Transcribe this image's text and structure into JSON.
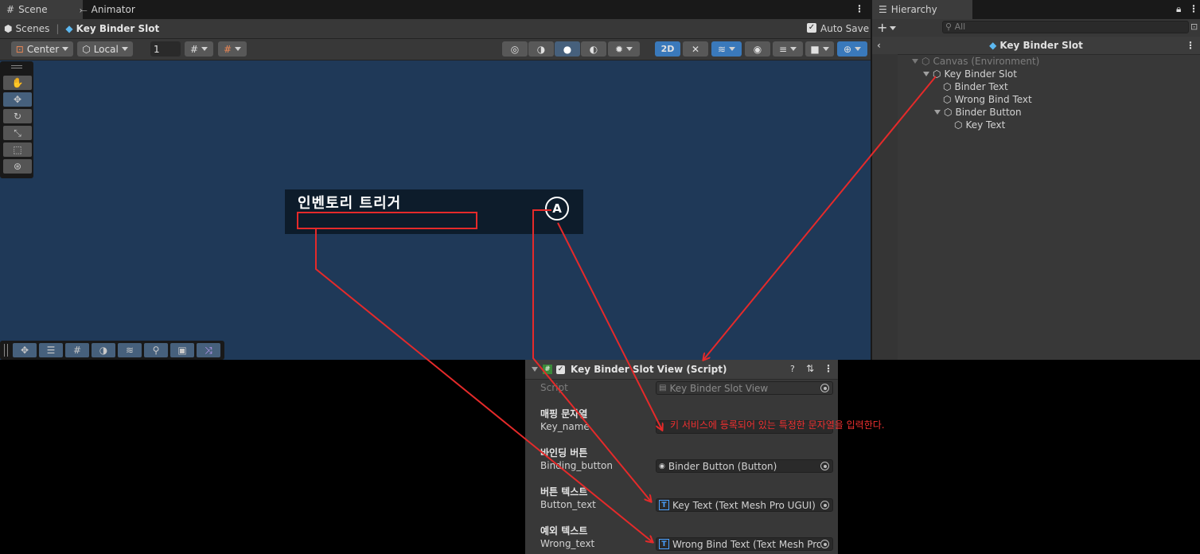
{
  "scene_window": {
    "tabs": [
      {
        "label": "Scene",
        "icon": "grid-icon"
      },
      {
        "label": "Animator",
        "icon": "animator-icon"
      }
    ],
    "breadcrumb": {
      "root": "Scenes",
      "current": "Key Binder Slot"
    },
    "auto_save_label": "Auto Save",
    "auto_save_checked": true,
    "toolbar": {
      "pivot_label": "Center",
      "space_label": "Local",
      "increment_value": "1",
      "mode_2d_label": "2D"
    },
    "slot": {
      "title": "인벤토리 트리거",
      "key_letter": "A"
    }
  },
  "hierarchy": {
    "tab_label": "Hierarchy",
    "search_placeholder": "All",
    "header": "Key Binder Slot",
    "items": [
      {
        "label": "Canvas (Environment)",
        "dim": true
      },
      {
        "label": "Key Binder Slot"
      },
      {
        "label": "Binder Text"
      },
      {
        "label": "Wrong Bind Text"
      },
      {
        "label": "Binder Button"
      },
      {
        "label": "Key Text"
      }
    ]
  },
  "inspector": {
    "component_title": "Key Binder Slot View (Script)",
    "script_label": "Script",
    "script_value": "Key Binder Slot View",
    "fields": [
      {
        "header": "매핑 문자열",
        "label": "Key_name",
        "value": ""
      },
      {
        "header": "바인딩 버튼",
        "label": "Binding_button",
        "value": "Binder Button (Button)"
      },
      {
        "header": "버튼 텍스트",
        "label": "Button_text",
        "value": "Key Text (Text Mesh Pro UGUI)"
      },
      {
        "header": "예외 텍스트",
        "label": "Wrong_text",
        "value": "Wrong Bind Text (Text Mesh Pro UGUI)"
      }
    ]
  },
  "annotation": "키 서비스에 등록되어 있는 특정한 문자열을 입력한다.",
  "colors": {
    "annotation_red": "#e52a2a",
    "scene_bg": "#1f3958",
    "panel_bg": "#383838",
    "accent_blue": "#46607c"
  }
}
